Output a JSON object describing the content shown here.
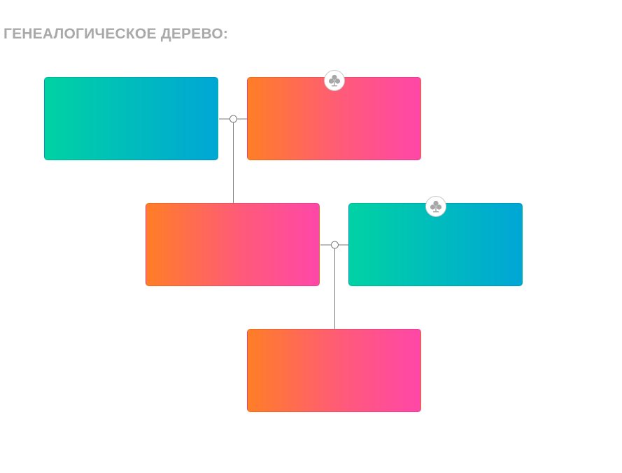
{
  "page": {
    "title": "ГЕНЕАЛОГИЧЕСКОЕ ДЕРЕВО:"
  },
  "persons": [
    {
      "id": "grandfather",
      "gender": "male",
      "generation": 1,
      "name": ""
    },
    {
      "id": "grandmother",
      "gender": "female",
      "generation": 1,
      "name": "",
      "has_tree_icon": true
    },
    {
      "id": "mother",
      "gender": "female",
      "generation": 2,
      "name": ""
    },
    {
      "id": "father",
      "gender": "male",
      "generation": 2,
      "name": "",
      "has_tree_icon": true
    },
    {
      "id": "child",
      "gender": "female",
      "generation": 3,
      "name": ""
    }
  ],
  "colors": {
    "male_gradient": [
      "#00d2a3",
      "#00a6d6"
    ],
    "female_gradient": [
      "#ff7e26",
      "#ff47a8"
    ],
    "connector": "#7a7a7a",
    "title": "#a9a9a9"
  },
  "icons": {
    "tree_badge": "family-tree-icon"
  }
}
